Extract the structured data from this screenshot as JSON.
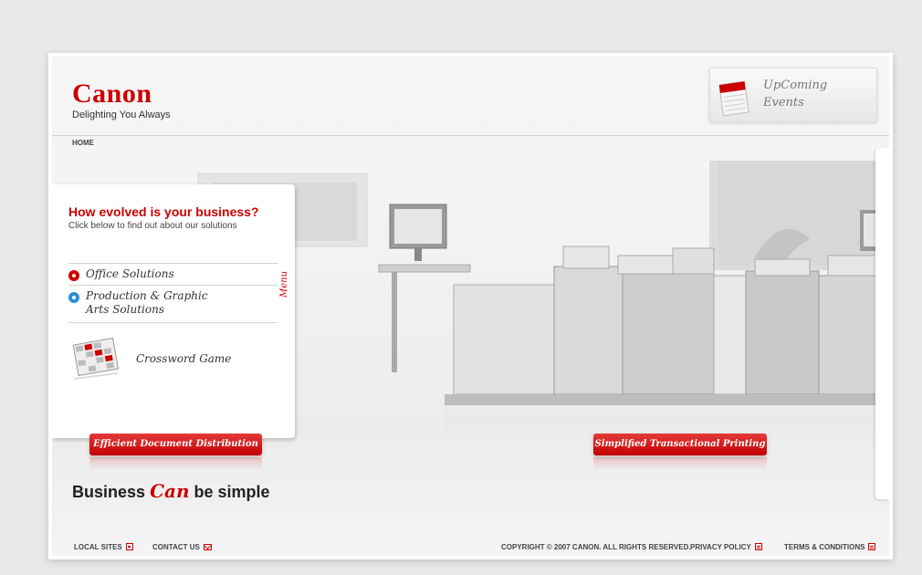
{
  "header": {
    "logo": "Canon",
    "tagline": "Delighting You Always",
    "events_line1": "UpComing",
    "events_line2": "Events",
    "breadcrumb": "HOME"
  },
  "panel": {
    "title": "How evolved is your business?",
    "subtitle": "Click below to find out about our solutions",
    "items": [
      {
        "label": "Office Solutions"
      },
      {
        "label_line1": "Production & Graphic",
        "label_line2": "Arts Solutions"
      }
    ],
    "menu_tab": "Menu",
    "crossword_label": "Crossword Game"
  },
  "buttons": {
    "efficient": "Efficient Document Distribution",
    "simplified": "Simplified Transactional Printing"
  },
  "slogan": {
    "before": "Business",
    "can": "Can",
    "after": "be simple"
  },
  "footer": {
    "local_sites": "LOCAL SITES",
    "contact_us": "CONTACT US",
    "copyright": "COPYRIGHT © 2007 CANON. ALL RIGHTS RESERVED.",
    "privacy": "PRIVACY POLICY",
    "terms": "TERMS & CONDITIONS"
  },
  "colors": {
    "brand_red": "#cc0000",
    "bullet_blue": "#2d8fd8"
  }
}
